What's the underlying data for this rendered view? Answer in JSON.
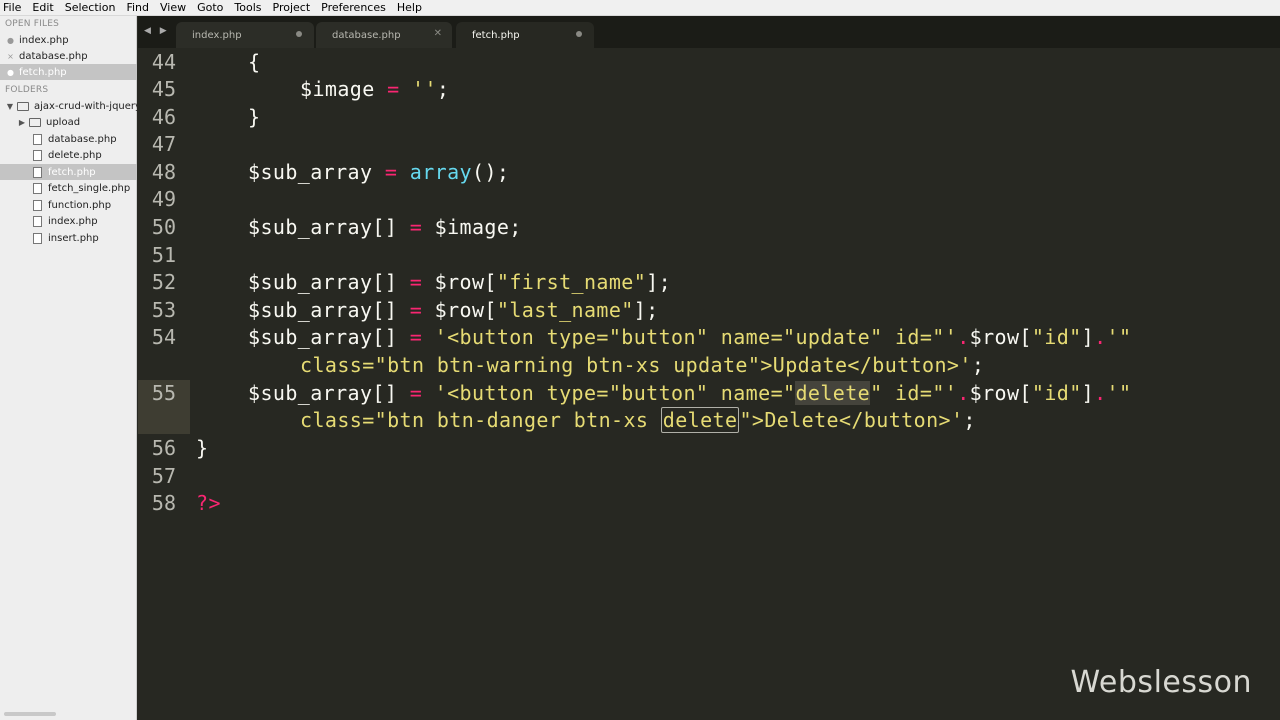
{
  "menu": [
    "File",
    "Edit",
    "Selection",
    "Find",
    "View",
    "Goto",
    "Tools",
    "Project",
    "Preferences",
    "Help"
  ],
  "sidebar": {
    "open_files_header": "OPEN FILES",
    "open_files": [
      {
        "name": "index.php",
        "mark": "●",
        "selected": false
      },
      {
        "name": "database.php",
        "mark": "×",
        "selected": false
      },
      {
        "name": "fetch.php",
        "mark": "●",
        "selected": true
      }
    ],
    "folders_header": "FOLDERS",
    "project_folder": "ajax-crud-with-jquery-",
    "subfolder": "upload",
    "files": [
      {
        "name": "database.php",
        "selected": false
      },
      {
        "name": "delete.php",
        "selected": false
      },
      {
        "name": "fetch.php",
        "selected": true
      },
      {
        "name": "fetch_single.php",
        "selected": false
      },
      {
        "name": "function.php",
        "selected": false
      },
      {
        "name": "index.php",
        "selected": false
      },
      {
        "name": "insert.php",
        "selected": false
      }
    ]
  },
  "tabs": [
    {
      "label": "index.php",
      "state": "dot",
      "active": false
    },
    {
      "label": "database.php",
      "state": "close",
      "active": false
    },
    {
      "label": "fetch.php",
      "state": "dot",
      "active": true
    }
  ],
  "tab_arrows": "◀ ▶",
  "editor": {
    "line_numbers": [
      "44",
      "45",
      "46",
      "47",
      "48",
      "49",
      "50",
      "51",
      "52",
      "53",
      "54",
      "",
      "55",
      "",
      "56",
      "57",
      "58"
    ],
    "current_line": "55",
    "code": {
      "l44": "{",
      "l45_var": "$image",
      "l45_op": "=",
      "l45_str": "''",
      "l45_end": ";",
      "l46": "}",
      "l48_var": "$sub_array",
      "l48_op": "=",
      "l48_fn": "array",
      "l48_end": "();",
      "l50_var": "$sub_array[]",
      "l50_op": "=",
      "l50_rest": "$image;",
      "l52_var": "$sub_array[]",
      "l52_op": "=",
      "l52_a": "$row[",
      "l52_str": "\"first_name\"",
      "l52_b": "];",
      "l53_var": "$sub_array[]",
      "l53_op": "=",
      "l53_a": "$row[",
      "l53_str": "\"last_name\"",
      "l53_b": "];",
      "l54_var": "$sub_array[]",
      "l54_op": "=",
      "l54_str1": "'<button type=\"button\" name=\"update\" id=\"'",
      "l54_dot1": ".",
      "l54_row": "$row[",
      "l54_str2": "\"id\"",
      "l54_close": "]",
      "l54_dot2": ".",
      "l54_str3": "'\"",
      "l54w_str": "class=\"btn btn-warning btn-xs update\">Update</button>'",
      "l54w_end": ";",
      "l55_var": "$sub_array[]",
      "l55_op": "=",
      "l55_str1a": "'<button type=\"button\" name=\"",
      "l55_hl1": "delete",
      "l55_str1b": "\" id=\"'",
      "l55_dot1": ".",
      "l55_row": "$row[",
      "l55_str2": "\"id\"",
      "l55_close": "]",
      "l55_dot2": ".",
      "l55_str3": "'\"",
      "l55w_str_a": "class=\"btn btn-danger btn-xs ",
      "l55w_hl": "delete",
      "l55w_str_b": "\">Delete</button>'",
      "l55w_end": ";",
      "l56": "}",
      "l58": "?>"
    }
  },
  "watermark": "Webslesson"
}
